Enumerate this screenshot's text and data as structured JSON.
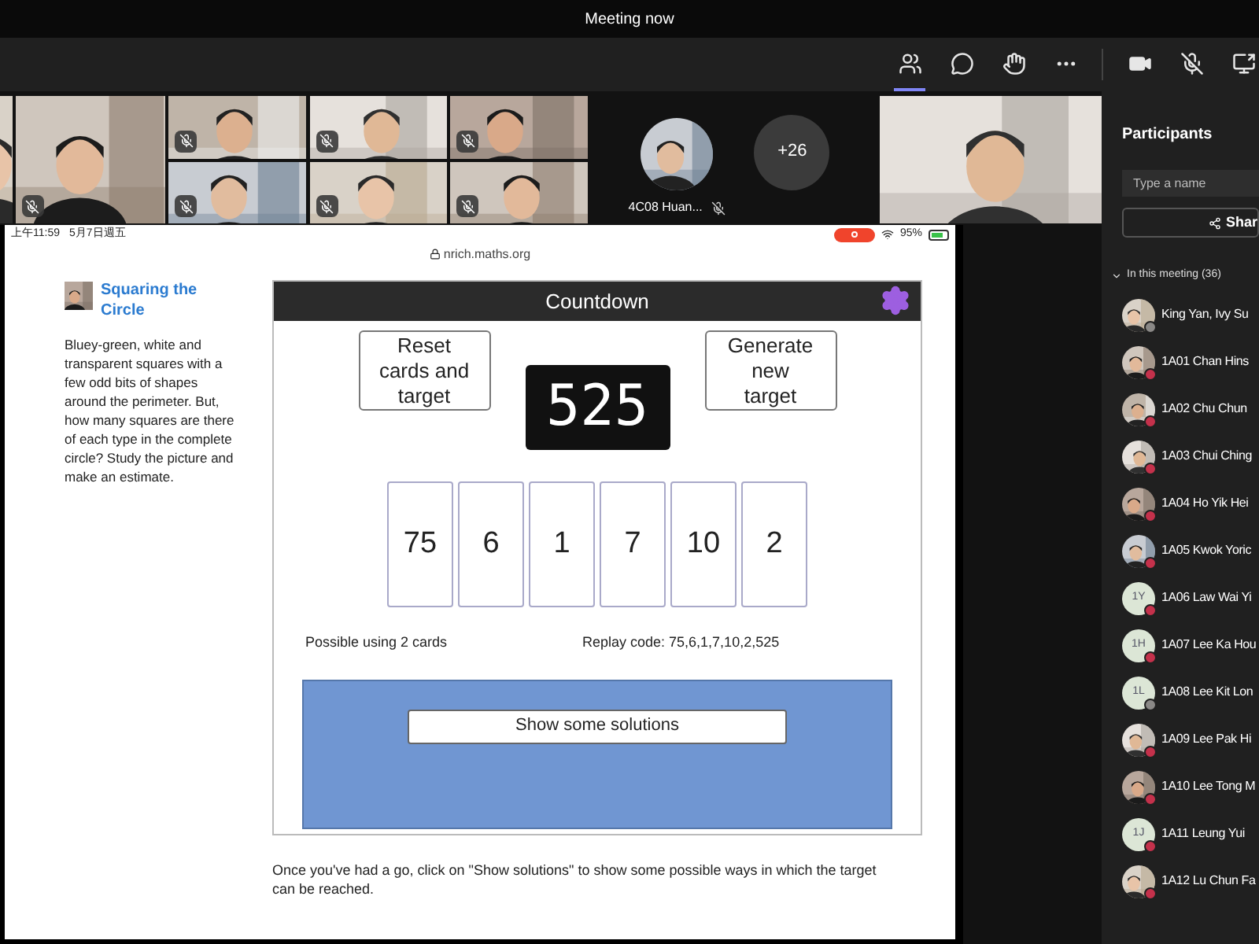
{
  "window": {
    "title": "Meeting now"
  },
  "toolbar": [
    {
      "kind": "people",
      "selected": true
    },
    {
      "kind": "chat",
      "selected": false
    },
    {
      "kind": "react",
      "selected": false
    },
    {
      "kind": "more",
      "selected": false
    },
    {
      "kind": "camera",
      "selected": false
    },
    {
      "kind": "mic_off",
      "selected": false
    },
    {
      "kind": "share",
      "selected": false
    }
  ],
  "video_strip": {
    "tiles": [
      {
        "kind": "picture",
        "muted": false
      },
      {
        "kind": "picture",
        "muted": true
      },
      {
        "kind": "picture",
        "muted": true
      },
      {
        "kind": "picture",
        "muted": true
      },
      {
        "kind": "picture",
        "muted": true
      },
      {
        "kind": "picture",
        "muted": true
      },
      {
        "kind": "picture",
        "muted": true
      },
      {
        "kind": "picture",
        "muted": true
      }
    ],
    "avatar_tile": {
      "name": "4C08 Huan...",
      "muted": true
    },
    "overflow_count": "+26",
    "speaker": {
      "kind": "picture",
      "muted": false
    }
  },
  "shared_screen": {
    "status_bar": {
      "time": "上午11:59",
      "date": "5月7日週五",
      "battery": "95%"
    },
    "url": "nrich.maths.org",
    "article": {
      "title": "Squaring the Circle",
      "text": "Bluey-green, white and transparent squares with a few odd bits of shapes around the perimeter. But, how many squares are there of each type in the complete circle? Study the picture and make an estimate."
    },
    "countdown": {
      "title": "Countdown",
      "reset_button": "Reset cards and target",
      "target": "525",
      "generate_button": "Generate new target",
      "cards": [
        "75",
        "6",
        "1",
        "7",
        "10",
        "2"
      ],
      "possible": "Possible using 2 cards",
      "replay_code": "Replay code: 75,6,1,7,10,2,525",
      "solutions_button": "Show some solutions"
    },
    "footer": "Once you've had a go, click on \"Show solutions\" to show some possible ways in which the target can be reached."
  },
  "participants": {
    "title": "Participants",
    "search": {
      "placeholder": "Type a name"
    },
    "share_button": "Shar",
    "section": {
      "label": "In this meeting (36)",
      "expanded": true
    },
    "people": [
      {
        "name": "King Yan, Ivy Su",
        "avatar": {
          "kind": "picture"
        },
        "color": "#8a8886"
      },
      {
        "name": "1A01 Chan Hins",
        "avatar": {
          "kind": "picture"
        },
        "color": "#c4314b"
      },
      {
        "name": "1A02 Chu Chun",
        "avatar": {
          "kind": "picture"
        },
        "color": "#c4314b"
      },
      {
        "name": "1A03 Chui Ching",
        "avatar": {
          "kind": "picture"
        },
        "color": "#c4314b"
      },
      {
        "name": "1A04 Ho Yik Hei",
        "avatar": {
          "kind": "picture"
        },
        "color": "#c4314b"
      },
      {
        "name": "1A05 Kwok Yoric",
        "avatar": {
          "kind": "picture"
        },
        "color": "#c4314b"
      },
      {
        "name": "1A06 Law Wai Yi",
        "avatar": {
          "kind": "initials",
          "initials": "1Y"
        },
        "color": "#c4314b"
      },
      {
        "name": "1A07 Lee Ka Hou",
        "avatar": {
          "kind": "initials",
          "initials": "1H"
        },
        "color": "#c4314b"
      },
      {
        "name": "1A08 Lee Kit Lon",
        "avatar": {
          "kind": "initials",
          "initials": "1L"
        },
        "color": "#8a8886"
      },
      {
        "name": "1A09 Lee Pak Hi",
        "avatar": {
          "kind": "picture"
        },
        "color": "#c4314b"
      },
      {
        "name": "1A10 Lee Tong M",
        "avatar": {
          "kind": "picture"
        },
        "color": "#c4314b"
      },
      {
        "name": "1A11 Leung Yui",
        "avatar": {
          "kind": "initials",
          "initials": "1J"
        },
        "color": "#c4314b"
      },
      {
        "name": "1A12 Lu Chun Fa",
        "avatar": {
          "kind": "picture"
        },
        "color": "#c4314b"
      }
    ]
  }
}
